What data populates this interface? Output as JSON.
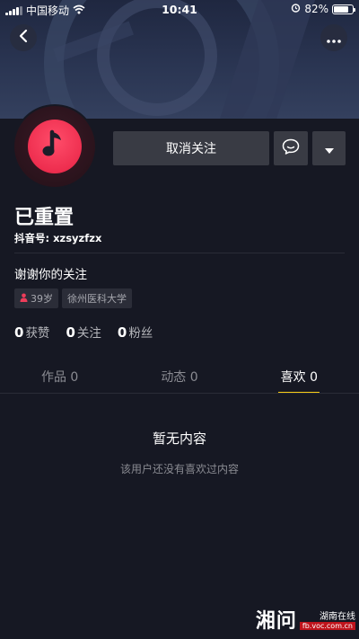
{
  "status_bar": {
    "carrier": "中国移动",
    "time": "10:41",
    "battery": "82%",
    "battery_level": 0.82
  },
  "profile": {
    "nickname": "已重置",
    "douyin_id": "抖音号: xzsyzfzx",
    "signature": "谢谢你的关注",
    "tags": {
      "age": "39岁",
      "school": "徐州医科大学"
    },
    "stats": {
      "likes": {
        "value": "0",
        "label": "获赞"
      },
      "following": {
        "value": "0",
        "label": "关注"
      },
      "followers": {
        "value": "0",
        "label": "粉丝"
      }
    }
  },
  "actions": {
    "unfollow_label": "取消关注"
  },
  "tabs": [
    {
      "label": "作品 0"
    },
    {
      "label": "动态 0"
    },
    {
      "label": "喜欢 0"
    }
  ],
  "active_tab": 2,
  "empty_state": {
    "title": "暂无内容",
    "description": "该用户还没有喜欢过内容"
  },
  "watermark": {
    "big": "湘问",
    "small": "湖南在线",
    "url": "fb.voc.com.cn"
  },
  "colors": {
    "background": "#161823",
    "accent_underline": "#face15",
    "avatar_red": "#ee2e4f",
    "button_bg": "#393b44"
  },
  "icons": [
    "back-icon",
    "more-icon",
    "music-note-icon",
    "message-icon",
    "dropdown-icon",
    "person-icon",
    "wifi-icon",
    "alarm-icon",
    "battery-icon"
  ]
}
